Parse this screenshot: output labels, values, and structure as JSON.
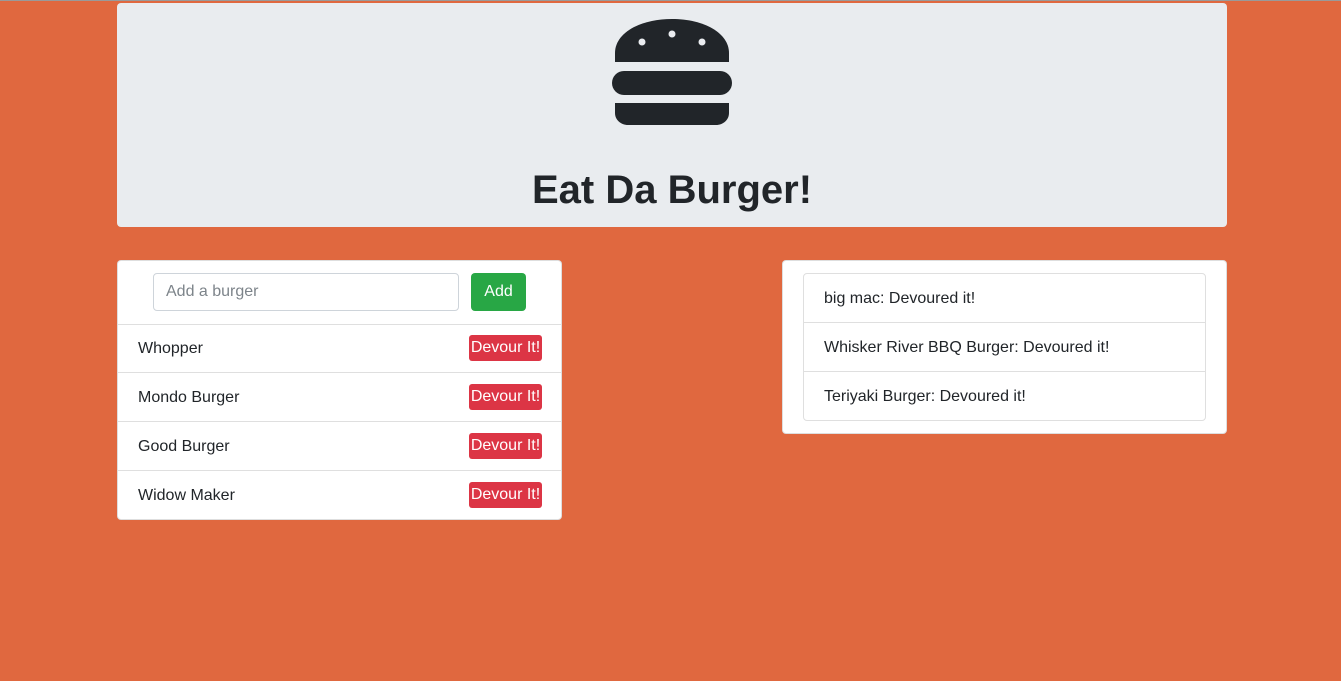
{
  "header": {
    "icon": "hamburger-icon",
    "title": "Eat Da Burger!"
  },
  "add_form": {
    "placeholder": "Add a burger",
    "value": "",
    "add_label": "Add"
  },
  "burgers": [
    {
      "name": "Whopper",
      "action": "Devour It!"
    },
    {
      "name": "Mondo Burger",
      "action": "Devour It!"
    },
    {
      "name": "Good Burger",
      "action": "Devour It!"
    },
    {
      "name": "Widow Maker",
      "action": "Devour It!"
    }
  ],
  "devoured": [
    {
      "text": "big mac: Devoured it!"
    },
    {
      "text": "Whisker River BBQ Burger: Devoured it!"
    },
    {
      "text": "Teriyaki Burger: Devoured it!"
    }
  ],
  "colors": {
    "background": "#e0683f",
    "header_bg": "#e9ecef",
    "add_button": "#28a745",
    "devour_button": "#dc3545",
    "icon": "#212529"
  }
}
